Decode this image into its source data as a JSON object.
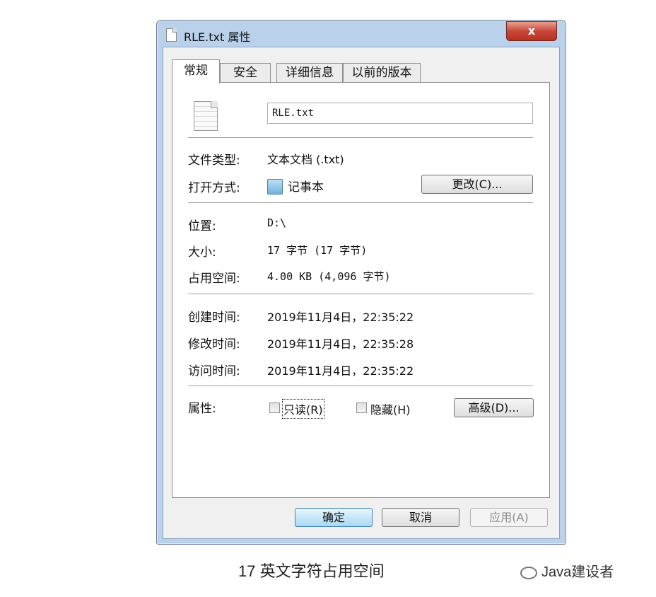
{
  "window": {
    "title": "RLE.txt 属性",
    "close_label": "x"
  },
  "tabs": [
    {
      "label": "常规",
      "active": true
    },
    {
      "label": "安全",
      "active": false
    },
    {
      "label": "详细信息",
      "active": false
    },
    {
      "label": "以前的版本",
      "active": false
    }
  ],
  "general": {
    "file_name": "RLE.txt",
    "file_type_label": "文件类型:",
    "file_type_value": "文本文档 (.txt)",
    "opens_with_label": "打开方式:",
    "opens_with_value": "记事本",
    "change_button": "更改(C)...",
    "location_label": "位置:",
    "location_value": "D:\\",
    "size_label": "大小:",
    "size_value": "17 字节 (17 字节)",
    "size_on_disk_label": "占用空间:",
    "size_on_disk_value": "4.00 KB (4,096 字节)",
    "created_label": "创建时间:",
    "created_value": "2019年11月4日，22:35:22",
    "modified_label": "修改时间:",
    "modified_value": "2019年11月4日，22:35:28",
    "accessed_label": "访问时间:",
    "accessed_value": "2019年11月4日，22:35:22",
    "attributes_label": "属性:",
    "readonly_label": "只读(R)",
    "readonly_checked": false,
    "hidden_label": "隐藏(H)",
    "hidden_checked": false,
    "advanced_button": "高级(D)..."
  },
  "footer": {
    "ok": "确定",
    "cancel": "取消",
    "apply": "应用(A)"
  },
  "caption": "17 英文字符占用空间",
  "watermark": "Java建设者",
  "icons": [
    "file-icon",
    "notepad-icon",
    "close-icon",
    "wechat-icon"
  ],
  "colors": {
    "accent": "#3c7fb1",
    "close": "#c9483a",
    "frame": "#b9d1ea"
  }
}
